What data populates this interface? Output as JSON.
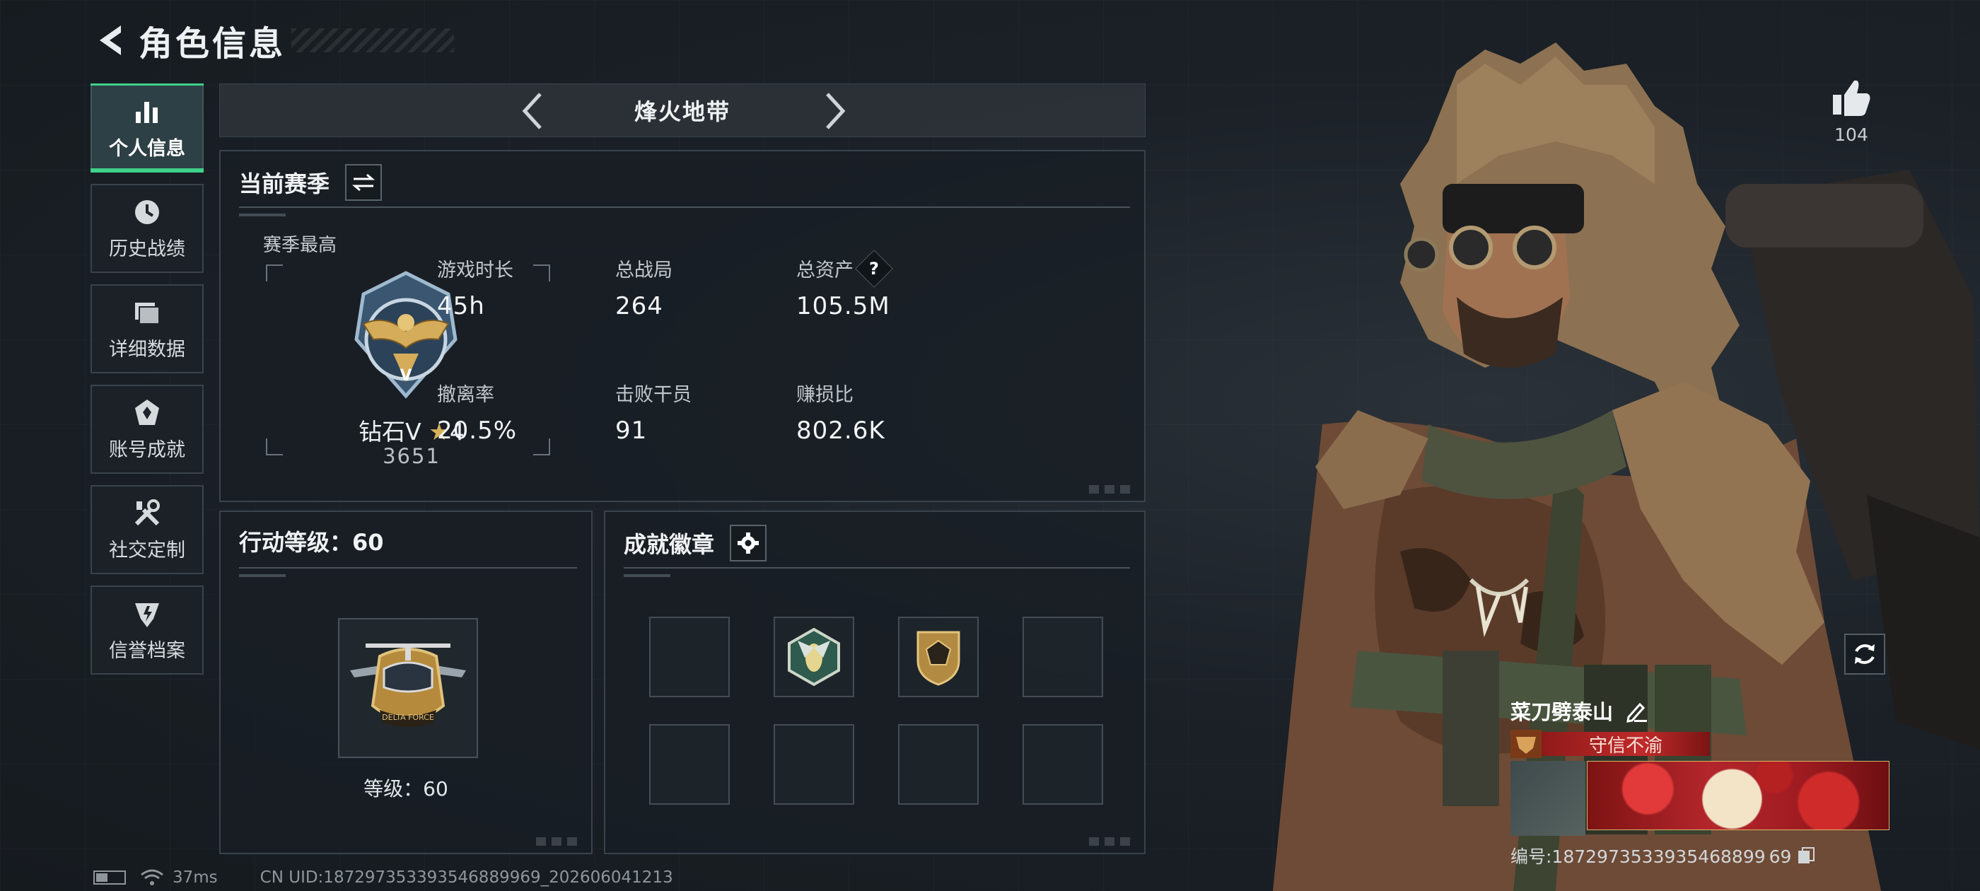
{
  "header": {
    "title": "角色信息"
  },
  "sidebar": {
    "items": [
      {
        "label": "个人信息",
        "icon": "bar-chart-icon",
        "active": true
      },
      {
        "label": "历史战绩",
        "icon": "history-icon"
      },
      {
        "label": "详细数据",
        "icon": "folder-icon"
      },
      {
        "label": "账号成就",
        "icon": "achievement-icon"
      },
      {
        "label": "社交定制",
        "icon": "tools-icon"
      },
      {
        "label": "信誉档案",
        "icon": "shield-icon"
      }
    ]
  },
  "map_selector": {
    "current": "烽火地带"
  },
  "season": {
    "title": "当前赛季",
    "best_label": "赛季最高",
    "rank_name": "钻石V",
    "rank_stars": "4",
    "rank_score": "3651",
    "stats": [
      {
        "label": "游戏时长",
        "value": "45h"
      },
      {
        "label": "总战局",
        "value": "264"
      },
      {
        "label": "总资产",
        "value": "105.5M",
        "help": "?"
      },
      {
        "label": "撤离率",
        "value": "20.5%"
      },
      {
        "label": "击败干员",
        "value": "91"
      },
      {
        "label": "赚损比",
        "value": "802.6K"
      }
    ]
  },
  "action_level": {
    "title": "行动等级：60",
    "level_text": "等级：60",
    "badge_text": "DELTA FORCE"
  },
  "achievements": {
    "title": "成就徽章"
  },
  "character": {
    "likes": "104",
    "player_name": "菜刀劈泰山",
    "player_title": "守信不渝",
    "uid_label": "编号:1872973533935468899 69"
  },
  "footer": {
    "ping": "37ms",
    "uid": "CN UID:187297353393546889969_202606041213"
  },
  "colors": {
    "accent_green": "#3fd18a",
    "title_red": "#c02a2a"
  }
}
